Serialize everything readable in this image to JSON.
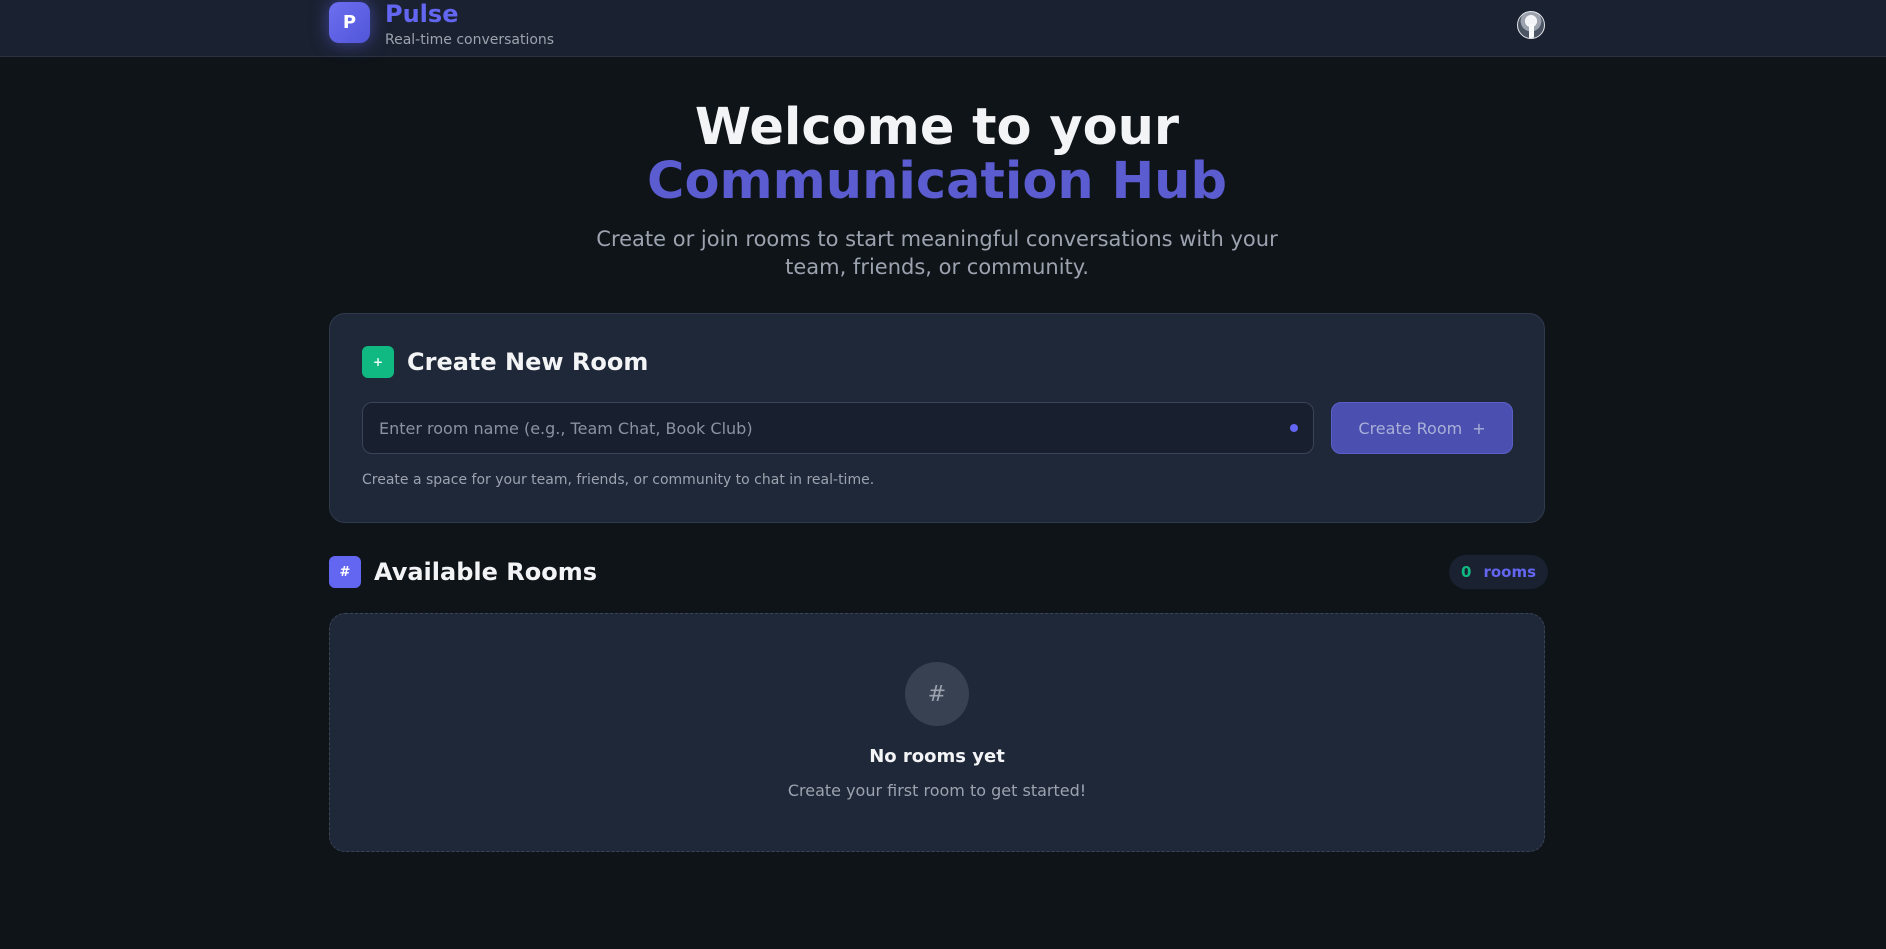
{
  "header": {
    "logo_letter": "P",
    "app_name": "Pulse",
    "tagline": "Real-time conversations",
    "avatar_icon": "user-avatar"
  },
  "hero": {
    "title_line1": "Welcome to your",
    "title_line2": "Communication Hub",
    "subtitle": "Create or join rooms to start meaningful conversations with your team, friends, or community."
  },
  "create_room": {
    "icon": "+",
    "title": "Create New Room",
    "input_value": "",
    "input_placeholder": "Enter room name (e.g., Team Chat, Book Club)",
    "button_label": "Create Room",
    "button_icon": "+",
    "hint": "Create a space for your team, friends, or community to chat in real-time."
  },
  "rooms": {
    "icon": "#",
    "title": "Available Rooms",
    "count": "0",
    "count_label": "rooms",
    "empty_icon": "#",
    "empty_title": "No rooms yet",
    "empty_subtitle": "Create your first room to get started!"
  },
  "colors": {
    "background": "#0f1419",
    "accent": "#6366f1",
    "success": "#10b981",
    "card": "#1f2839"
  }
}
